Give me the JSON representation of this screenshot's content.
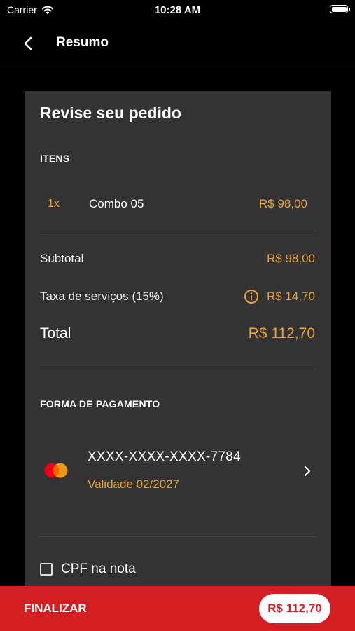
{
  "status_bar": {
    "carrier": "Carrier",
    "time": "10:28 AM"
  },
  "nav": {
    "title": "Resumo"
  },
  "review": {
    "title": "Revise seu pedido",
    "items_label": "ITENS",
    "items": [
      {
        "qty": "1x",
        "name": "Combo 05",
        "price": "R$ 98,00"
      }
    ],
    "subtotal_label": "Subtotal",
    "subtotal_value": "R$ 98,00",
    "service_fee_label": "Taxa de serviços (15%)",
    "service_fee_value": "R$ 14,70",
    "total_label": "Total",
    "total_value": "R$ 112,70"
  },
  "payment": {
    "label": "FORMA DE PAGAMENTO",
    "card_number": "XXXX-XXXX-XXXX-7784",
    "validity": "Validade 02/2027",
    "card_brand_icon": "mastercard-icon"
  },
  "cpf": {
    "label": "CPF na nota",
    "checked": false
  },
  "footer": {
    "finalize_label": "FINALIZAR",
    "total": "R$ 112,70"
  },
  "colors": {
    "accent": "#E8A23B",
    "brand_red": "#D41F22",
    "card_bg": "#333333",
    "background": "#000000"
  }
}
